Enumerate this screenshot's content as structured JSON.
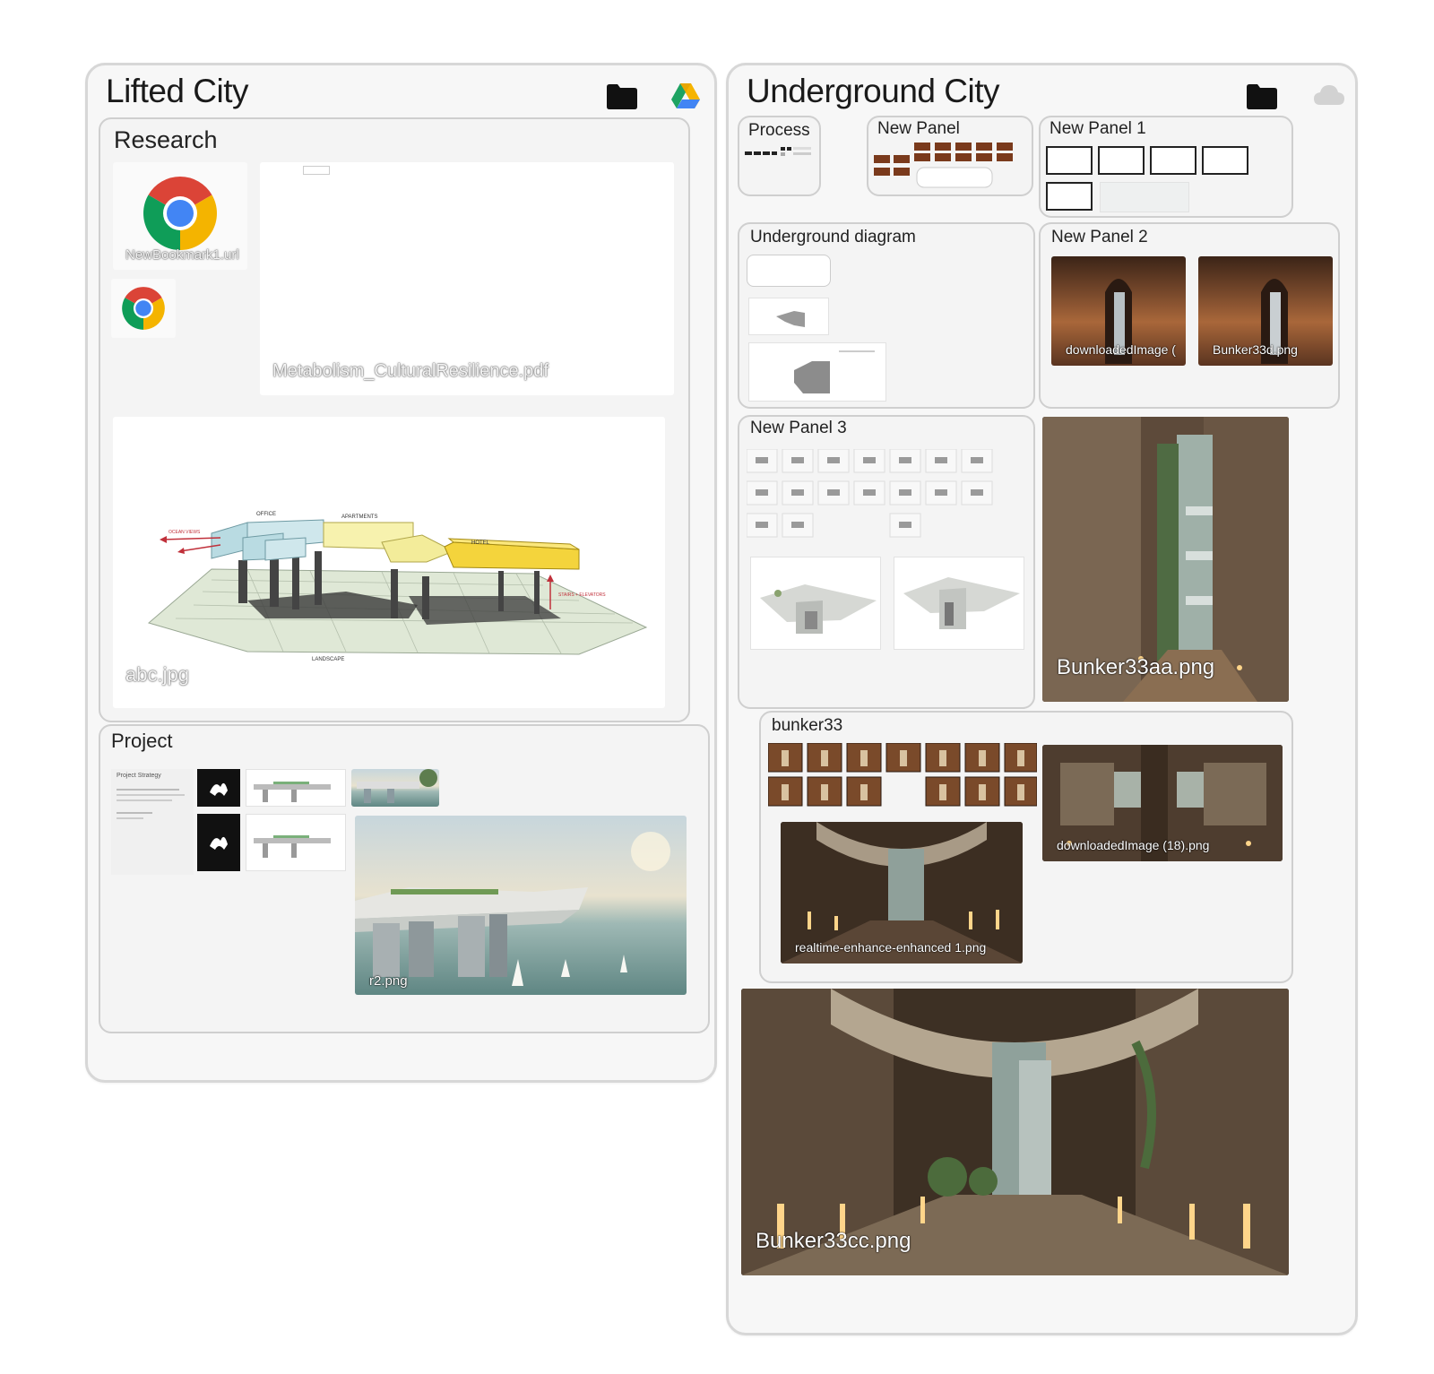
{
  "lifted_city": {
    "title": "Lifted City",
    "folder_icon": "folder-icon",
    "drive_icon": "google-drive-icon",
    "research": {
      "title": "Research",
      "bookmark_label": "NewBookmark1.url",
      "pdf_label": "Metabolism_CulturalResilience.pdf",
      "diagram_label": "abc.jpg",
      "diagram_annotations": {
        "office": "OFFICE",
        "apartments": "APARTMENTS",
        "hotel": "HOTEL",
        "ocean_views": "OCEAN VIEWS",
        "stairs": "STAIRS + ELEVATORS",
        "landscape": "LANDSCAPE"
      }
    },
    "project": {
      "title": "Project",
      "doc_heading": "Project Strategy",
      "render_label": "r2.png"
    }
  },
  "underground_city": {
    "title": "Underground City",
    "folder_icon": "folder-icon",
    "cloud_icon": "cloud-icon",
    "process": {
      "title": "Process"
    },
    "new_panel": {
      "title": "New Panel"
    },
    "new_panel_1": {
      "title": "New Panel 1"
    },
    "underground_diagram": {
      "title": "Underground diagram"
    },
    "new_panel_2": {
      "title": "New Panel 2",
      "images": [
        "downloadedImage (",
        "Bunker33d.png"
      ]
    },
    "new_panel_3": {
      "title": "New Panel 3"
    },
    "bunker33aa_label": "Bunker33aa.png",
    "bunker33": {
      "title": "bunker33",
      "downloaded_label": "downloadedImage (18).png",
      "realtime_label": "realtime-enhance-enhanced 1.png"
    },
    "bunker33cc_label": "Bunker33cc.png"
  }
}
